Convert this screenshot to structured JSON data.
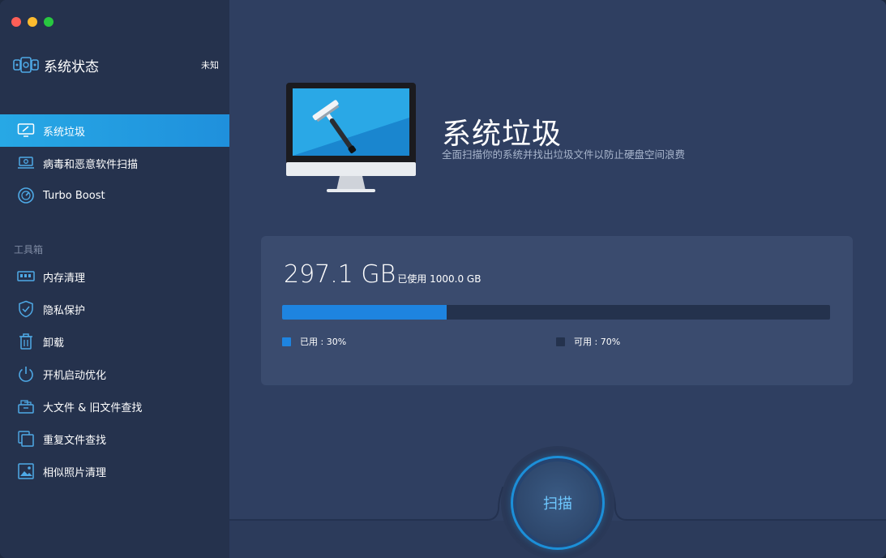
{
  "window": {
    "traffic_lights": [
      "close",
      "minimize",
      "maximize"
    ]
  },
  "sidebar": {
    "status": {
      "title": "系统状态",
      "value": "未知",
      "icon": "system-status-icon"
    },
    "main_items": [
      {
        "label": "系统垃圾",
        "icon": "monitor-clean-icon",
        "active": true
      },
      {
        "label": "病毒和恶意软件扫描",
        "icon": "laptop-scan-icon",
        "active": false
      },
      {
        "label": "Turbo Boost",
        "icon": "speedometer-icon",
        "active": false
      }
    ],
    "section_label": "工具箱",
    "tool_items": [
      {
        "label": "内存清理",
        "icon": "memory-icon"
      },
      {
        "label": "隐私保护",
        "icon": "shield-icon"
      },
      {
        "label": "卸载",
        "icon": "trash-icon"
      },
      {
        "label": "开机启动优化",
        "icon": "power-icon"
      },
      {
        "label": "大文件 & 旧文件查找",
        "icon": "file-box-icon"
      },
      {
        "label": "重复文件查找",
        "icon": "duplicate-files-icon"
      },
      {
        "label": "相似照片清理",
        "icon": "photo-icon"
      }
    ]
  },
  "main": {
    "title": "系统垃圾",
    "subtitle": "全面扫描你的系统并找出垃圾文件以防止硬盘空间浪费",
    "disk": {
      "used_big": "297.1 GB",
      "used_caption": "已使用 1000.0 GB",
      "used_fraction": 0.3,
      "legend_used": "已用 : 30%",
      "legend_free": "可用 : 70%",
      "used_color": "#1e84e0",
      "free_color": "#24324d"
    },
    "scan_button": "扫描"
  },
  "colors": {
    "sidebar_bg": "#25324d",
    "main_bg": "#2f3f61",
    "accent": "#27a8e5"
  }
}
